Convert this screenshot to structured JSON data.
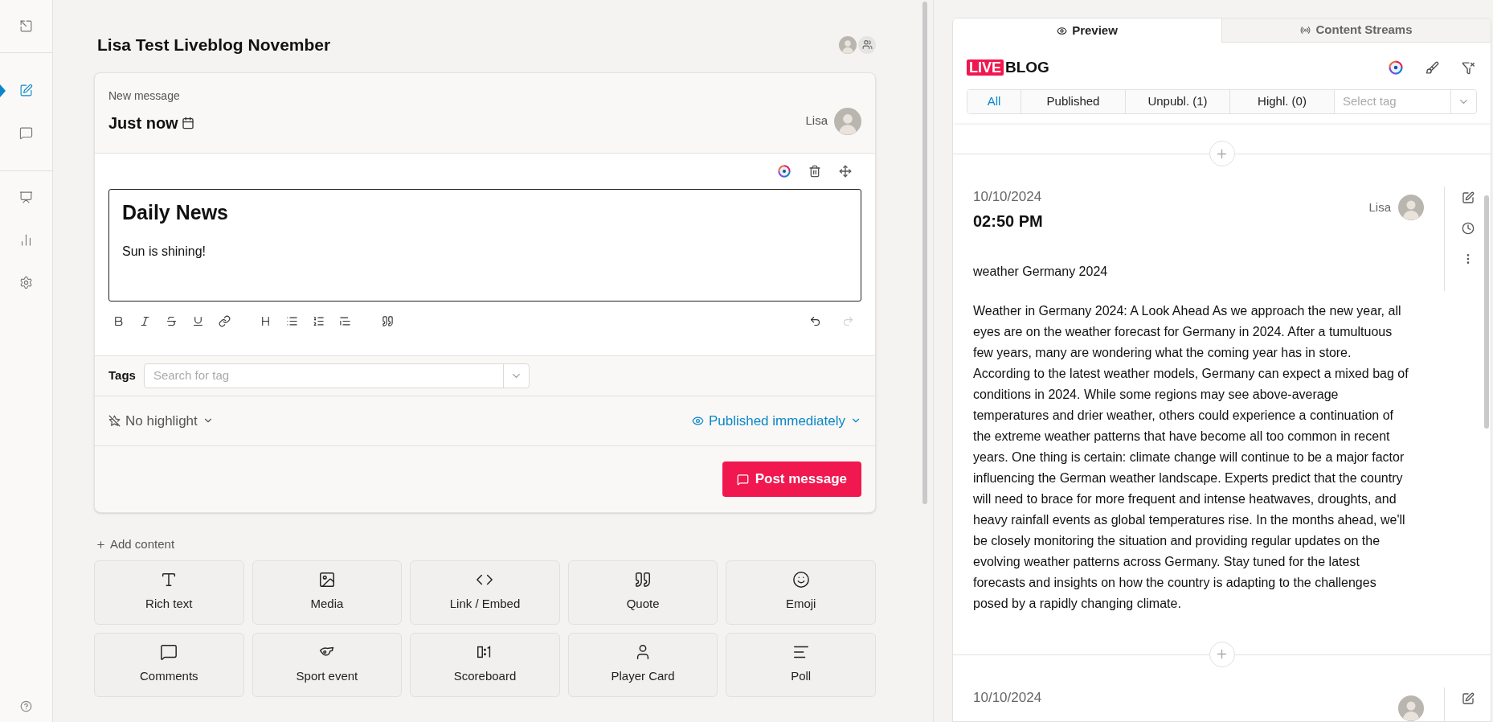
{
  "sidebar": {
    "items": [
      {
        "kind": "exit",
        "selected": false
      },
      {
        "kind": "edit",
        "selected": true
      },
      {
        "kind": "comments",
        "selected": false
      },
      {
        "kind": "present",
        "selected": false
      },
      {
        "kind": "stats",
        "selected": false
      },
      {
        "kind": "settings",
        "selected": false
      }
    ]
  },
  "editor": {
    "title": "Lisa Test Liveblog November",
    "message": {
      "label": "New message",
      "time": "Just now",
      "author": "Lisa",
      "heading": "Daily News",
      "body": "Sun is shining!"
    },
    "toolbar": [
      {
        "kind": "bold",
        "disabled": false
      },
      {
        "kind": "italic",
        "disabled": false
      },
      {
        "kind": "strike",
        "disabled": false
      },
      {
        "kind": "underline",
        "disabled": false
      },
      {
        "kind": "link",
        "disabled": false
      },
      {
        "kind": "heading",
        "disabled": false
      },
      {
        "kind": "bullets",
        "disabled": false
      },
      {
        "kind": "numbered",
        "disabled": false
      },
      {
        "kind": "indent",
        "disabled": false
      },
      {
        "kind": "quote",
        "disabled": false
      },
      {
        "kind": "undo",
        "disabled": false
      },
      {
        "kind": "redo",
        "disabled": true
      }
    ],
    "tags": {
      "label": "Tags",
      "placeholder": "Search for tag"
    },
    "highlight": "No highlight",
    "publish": "Published immediately",
    "post_button": "Post message",
    "add_content": "Add content",
    "content_types": [
      {
        "kind": "text",
        "label": "Rich text"
      },
      {
        "kind": "media",
        "label": "Media"
      },
      {
        "kind": "embed",
        "label": "Link / Embed"
      },
      {
        "kind": "quote",
        "label": "Quote"
      },
      {
        "kind": "emoji",
        "label": "Emoji"
      },
      {
        "kind": "comments",
        "label": "Comments"
      },
      {
        "kind": "whistle",
        "label": "Sport event"
      },
      {
        "kind": "score",
        "label": "Scoreboard"
      },
      {
        "kind": "player",
        "label": "Player Card"
      },
      {
        "kind": "poll",
        "label": "Poll"
      }
    ]
  },
  "preview": {
    "tabs": [
      {
        "kind": "eye",
        "label": "Preview",
        "selected": true
      },
      {
        "kind": "broadcast",
        "label": "Content Streams",
        "selected": false
      }
    ],
    "logo": {
      "mark": "LIVE",
      "text": "BLOG"
    },
    "filters": [
      {
        "label": "All",
        "selected": true
      },
      {
        "label": "Published",
        "selected": false
      },
      {
        "label": "Unpubl. (1)",
        "selected": false
      },
      {
        "label": "Highl. (0)",
        "selected": false
      }
    ],
    "tag_select": {
      "placeholder": "Select tag"
    },
    "posts": [
      {
        "date": "10/10/2024",
        "time": "02:50 PM",
        "author": "Lisa",
        "title": "weather Germany 2024",
        "body": "Weather in Germany 2024: A Look Ahead As we approach the new year, all eyes are on the weather forecast for Germany in 2024. After a tumultuous few years, many are wondering what the coming year has in store. According to the latest weather models, Germany can expect a mixed bag of conditions in 2024. While some regions may see above-average temperatures and drier weather, others could experience a continuation of the extreme weather patterns that have become all too common in recent years. One thing is certain: climate change will continue to be a major factor influencing the German weather landscape. Experts predict that the country will need to brace for more frequent and intense heatwaves, droughts, and heavy rainfall events as global temperatures rise. In the months ahead, we'll be closely monitoring the situation and providing regular updates on the evolving weather patterns across Germany. Stay tuned for the latest forecasts and insights on how the country is adapting to the challenges posed by a rapidly changing climate."
      },
      {
        "date": "10/10/2024"
      }
    ]
  }
}
